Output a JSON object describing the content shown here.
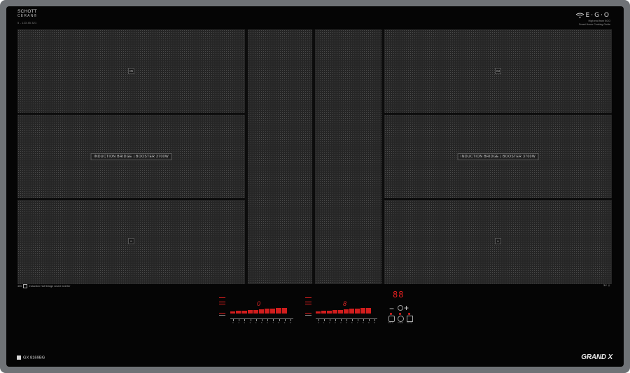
{
  "brand": {
    "name": "SCHOTT",
    "sub": "CERAN®",
    "serial": "5 - 123 45 321"
  },
  "ego": {
    "logo": "E·G·O",
    "tag": "High end from EGO",
    "tag2": "Smart Home Cooking Guide"
  },
  "zones": {
    "left": {
      "marker_top": "IN",
      "bridge_label": "INDUCTION BRIDGE | BOOSTER 3700W",
      "marker_bottom": "♨"
    },
    "right": {
      "marker_top": "IN",
      "bridge_label": "INDUCTION BRIDGE | BOOSTER 3700W",
      "marker_bottom": "♨"
    }
  },
  "footer": {
    "left_text": "Induction Half bridge smart inverter",
    "left_prefix": "400",
    "right_text": "3V",
    "right_icon": "ground-icon",
    "model": "GX 8169BG",
    "grandx": "GRAND X"
  },
  "controls": {
    "left": {
      "power_digit": "0",
      "levels": [
        "0",
        "1",
        "2",
        "3",
        "4",
        "5",
        "6",
        "7",
        "8",
        "9",
        "P"
      ],
      "level": 9
    },
    "right": {
      "power_digit": "8",
      "levels": [
        "0",
        "1",
        "2",
        "3",
        "4",
        "5",
        "6",
        "7",
        "8",
        "9",
        "P"
      ],
      "level": 9
    }
  },
  "timer": {
    "digits": "88",
    "minus": "−",
    "plus": "+",
    "captions": [
      "CHILD",
      "TIMER",
      "PAUSE"
    ]
  },
  "colors": {
    "led_red": "#e31f1f",
    "glass": "#050505",
    "frame": "#6f7276"
  }
}
